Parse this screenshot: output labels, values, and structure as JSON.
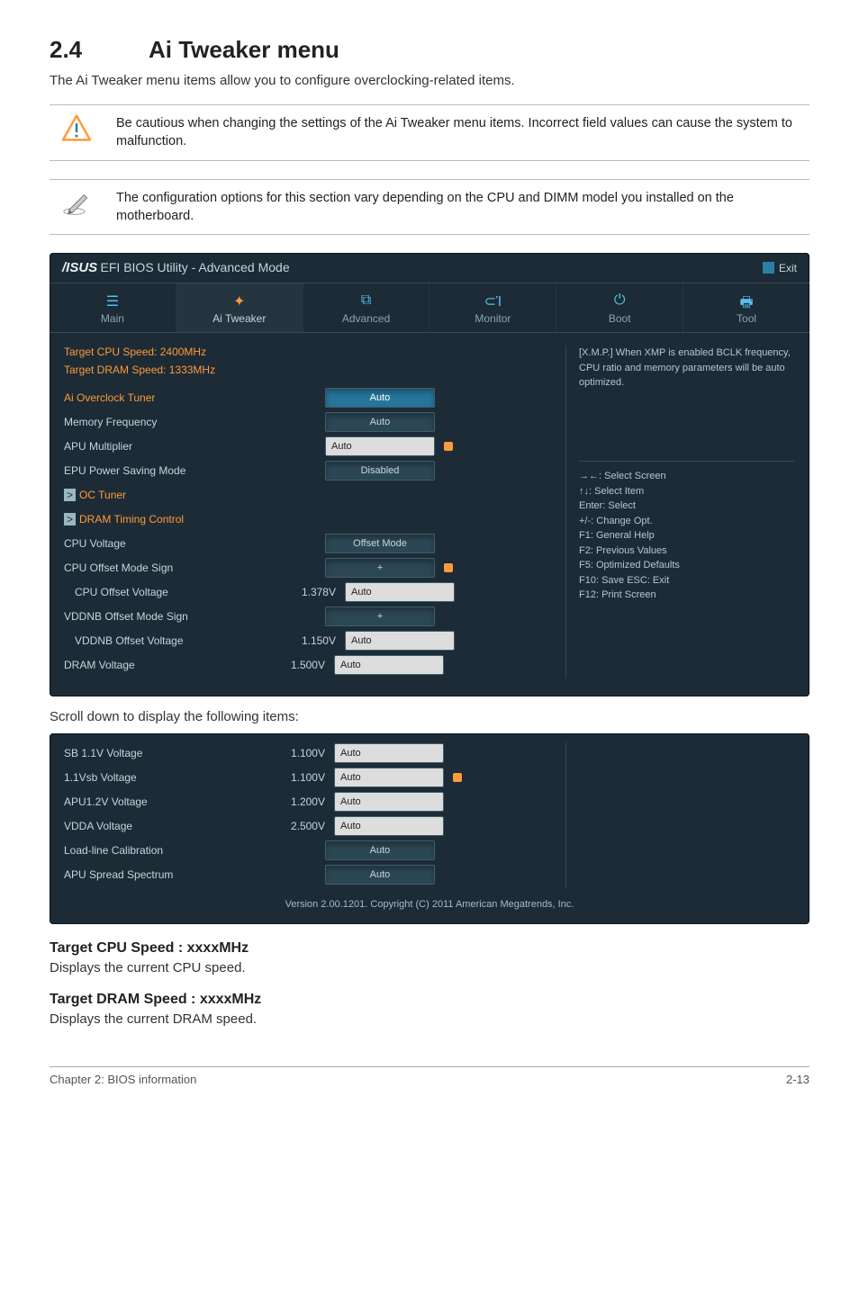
{
  "section": {
    "number": "2.4",
    "title": "Ai Tweaker menu",
    "intro": "The Ai Tweaker menu items allow you to configure overclocking-related items."
  },
  "notes": {
    "warning": "Be cautious when changing the settings of the Ai Tweaker menu items. Incorrect field values can cause the system to malfunction.",
    "info": "The configuration options for this section vary depending on the CPU and DIMM model you installed on the motherboard."
  },
  "bios": {
    "logo_text": "/ISUS",
    "title": "EFI BIOS Utility - Advanced Mode",
    "exit": "Exit",
    "tabs": [
      {
        "label": "Main",
        "icon": "☰"
      },
      {
        "label": "Ai  Tweaker",
        "icon": "⚙"
      },
      {
        "label": "Advanced",
        "icon": "⧉"
      },
      {
        "label": "Monitor",
        "icon": "⊂Ί"
      },
      {
        "label": "Boot",
        "icon": "⏻"
      },
      {
        "label": "Tool",
        "icon": "🖶"
      }
    ],
    "speeds": {
      "cpu": "Target CPU Speed: 2400MHz",
      "dram": "Target DRAM Speed: 1333MHz"
    },
    "rows_main": [
      {
        "label": "Ai Overclock Tuner",
        "value": "Auto",
        "type": "dropdown",
        "orange": true,
        "selected": true
      },
      {
        "label": "Memory Frequency",
        "value": "Auto",
        "type": "dropdown"
      },
      {
        "label": "APU Multiplier",
        "value": "Auto",
        "type": "edit"
      },
      {
        "label": "EPU Power Saving Mode",
        "value": "Disabled",
        "type": "dropdown"
      },
      {
        "label": "OC Tuner",
        "value": "",
        "type": "link",
        "orange": true,
        "prefix": ">"
      },
      {
        "label": "DRAM Timing Control",
        "value": "",
        "type": "link",
        "orange": true,
        "prefix": ">"
      },
      {
        "label": "CPU Voltage",
        "value": "Offset Mode",
        "type": "dropdown"
      },
      {
        "label": "CPU Offset Mode Sign",
        "value": "+",
        "type": "dropdown"
      },
      {
        "label": "CPU Offset Voltage",
        "readout": "1.378V",
        "value": "Auto",
        "type": "edit",
        "indent": true
      },
      {
        "label": "VDDNB Offset Mode Sign",
        "value": "+",
        "type": "dropdown"
      },
      {
        "label": "VDDNB Offset Voltage",
        "readout": "1.150V",
        "value": "Auto",
        "type": "edit",
        "indent": true
      },
      {
        "label": "DRAM Voltage",
        "readout": "1.500V",
        "value": "Auto",
        "type": "edit"
      }
    ],
    "help_top": "[X.M.P.] When XMP is enabled BCLK frequency, CPU ratio and memory parameters will be auto optimized.",
    "help_keys": "→←: Select Screen\n↑↓: Select Item\nEnter: Select\n+/-: Change Opt.\nF1: General Help\nF2: Previous Values\nF5: Optimized Defaults\nF10: Save   ESC: Exit\nF12: Print Screen",
    "rows_scroll": [
      {
        "label": "SB 1.1V Voltage",
        "readout": "1.100V",
        "value": "Auto",
        "type": "edit"
      },
      {
        "label": "1.1Vsb Voltage",
        "readout": "1.100V",
        "value": "Auto",
        "type": "edit"
      },
      {
        "label": "APU1.2V Voltage",
        "readout": "1.200V",
        "value": "Auto",
        "type": "edit"
      },
      {
        "label": "VDDA Voltage",
        "readout": "2.500V",
        "value": "Auto",
        "type": "edit"
      },
      {
        "label": "Load-line Calibration",
        "value": "Auto",
        "type": "dropdown"
      },
      {
        "label": "APU Spread Spectrum",
        "value": "Auto",
        "type": "dropdown"
      }
    ],
    "version": "Version 2.00.1201.   Copyright (C) 2011 American Megatrends, Inc."
  },
  "scroll_instruction": "Scroll down to display the following items:",
  "targets": {
    "cpu_heading": "Target CPU Speed : xxxxMHz",
    "cpu_desc": "Displays the current CPU speed.",
    "dram_heading": "Target DRAM Speed : xxxxMHz",
    "dram_desc": "Displays the current DRAM speed."
  },
  "footer": {
    "left": "Chapter 2: BIOS information",
    "right": "2-13"
  }
}
